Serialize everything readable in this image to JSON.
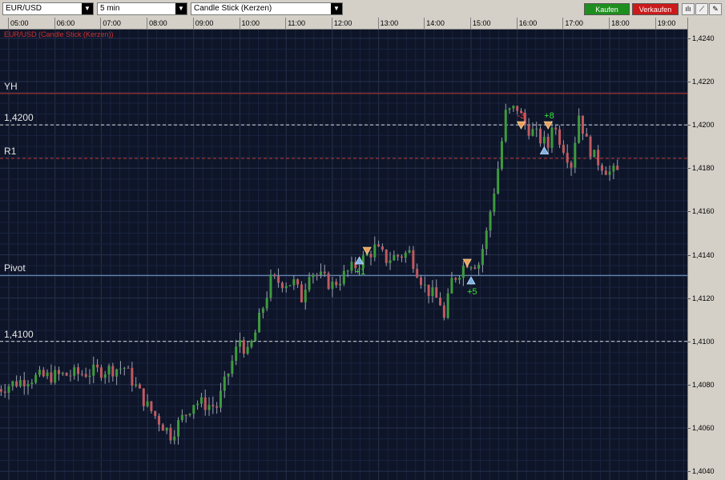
{
  "toolbar": {
    "symbol": "EUR/USD",
    "interval": "5 min",
    "chart_style": "Candle Stick (Kerzen)",
    "buy_label": "Kaufen",
    "sell_label": "Verkaufen",
    "buy_color": "#1e8f1e",
    "sell_color": "#cc1a1a",
    "tools": [
      "bars-icon",
      "line-draw-icon",
      "pen-icon"
    ]
  },
  "chart_data": {
    "type": "candlestick",
    "title": "EUR/USD (Candle Stick (Kerzen))",
    "x_labels": [
      "05:00",
      "06:00",
      "07:00",
      "08:00",
      "09:00",
      "10:00",
      "11:00",
      "12:00",
      "13:00",
      "14:00",
      "15:00",
      "16:00",
      "17:00",
      "18:00",
      "19:00"
    ],
    "y_tick_labels": [
      "1,4240",
      "1,4220",
      "1,4200",
      "1,4180",
      "1,4160",
      "1,4140",
      "1,4120",
      "1,4100",
      "1,4080",
      "1,4060",
      "1,4040"
    ],
    "ylim": [
      1.4036,
      1.4244
    ],
    "grid": true,
    "up_color": "#3d9b3d",
    "down_color": "#c05a60",
    "background": "#0e1528",
    "anchors": [
      [
        "04:45",
        1.4078
      ],
      [
        "05:25",
        1.4083
      ],
      [
        "06:30",
        1.4085
      ],
      [
        "07:30",
        1.4088
      ],
      [
        "08:00",
        1.407
      ],
      [
        "08:30",
        1.4057
      ],
      [
        "09:00",
        1.4072
      ],
      [
        "09:30",
        1.407
      ],
      [
        "10:00",
        1.4101
      ],
      [
        "10:10",
        1.4094
      ],
      [
        "10:20",
        1.4104
      ],
      [
        "10:40",
        1.4128
      ],
      [
        "11:10",
        1.4127
      ],
      [
        "11:20",
        1.412
      ],
      [
        "11:30",
        1.4133
      ],
      [
        "12:00",
        1.4126
      ],
      [
        "12:20",
        1.4132
      ],
      [
        "12:40",
        1.4138
      ],
      [
        "12:55",
        1.4143
      ],
      [
        "13:10",
        1.4138
      ],
      [
        "13:40",
        1.4141
      ],
      [
        "14:00",
        1.4125
      ],
      [
        "14:20",
        1.4118
      ],
      [
        "14:25",
        1.411
      ],
      [
        "14:35",
        1.4128
      ],
      [
        "14:55",
        1.4137
      ],
      [
        "15:10",
        1.4136
      ],
      [
        "15:20",
        1.415
      ],
      [
        "15:35",
        1.418
      ],
      [
        "15:45",
        1.4205
      ],
      [
        "16:00",
        1.4208
      ],
      [
        "16:10",
        1.42
      ],
      [
        "16:40",
        1.419
      ],
      [
        "16:45",
        1.4201
      ],
      [
        "17:00",
        1.419
      ],
      [
        "17:10",
        1.4182
      ],
      [
        "17:20",
        1.4205
      ],
      [
        "17:30",
        1.4192
      ],
      [
        "17:40",
        1.4185
      ],
      [
        "18:00",
        1.4178
      ],
      [
        "18:10",
        1.4178
      ]
    ],
    "levels": [
      {
        "label": "YH",
        "value": 1.42145,
        "color": "#c0392b",
        "style": "solid"
      },
      {
        "label": "1,4200",
        "value": 1.42,
        "color": "#dddddd",
        "style": "dashed"
      },
      {
        "label": "R1",
        "value": 1.41845,
        "color": "#c0392b",
        "style": "dashed"
      },
      {
        "label": "Pivot",
        "value": 1.41305,
        "color": "#7fa6d9",
        "style": "solid"
      },
      {
        "label": "1,4100",
        "value": 1.41,
        "color": "#dddddd",
        "style": "dashed"
      }
    ],
    "trades": [
      {
        "time": "12:35",
        "price": 1.41372,
        "dir": "buy",
        "label": "+1"
      },
      {
        "time": "12:45",
        "price": 1.4142,
        "dir": "sell",
        "label": ""
      },
      {
        "time": "15:00",
        "price": 1.4128,
        "dir": "buy",
        "label": "+5"
      },
      {
        "time": "14:55",
        "price": 1.41365,
        "dir": "sell",
        "label": ""
      },
      {
        "time": "16:05",
        "price": 1.42,
        "dir": "sell",
        "label": "-3"
      },
      {
        "time": "16:40",
        "price": 1.42,
        "dir": "sell",
        "label": "+8"
      },
      {
        "time": "16:35",
        "price": 1.4188,
        "dir": "buy",
        "label": ""
      }
    ]
  }
}
